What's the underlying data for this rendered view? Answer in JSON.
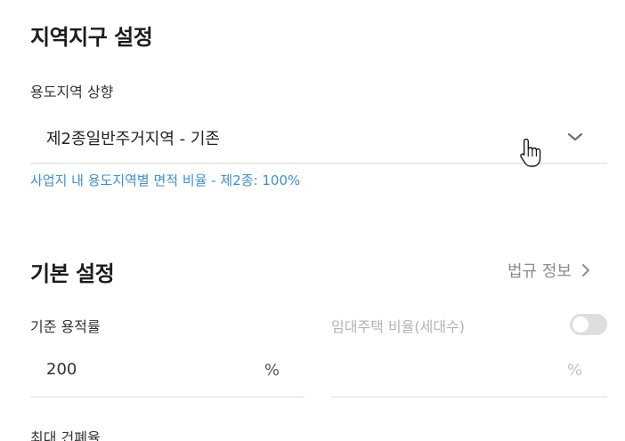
{
  "zoning": {
    "title": "지역지구 설정",
    "upgrade_label": "용도지역 상향",
    "selected": "제2종일반주거지역 - 기존",
    "hint": "사업지 내 용도지역별 면적 비율 - 제2종: 100%"
  },
  "basic": {
    "title": "기본 설정",
    "law_link": "법규 정보",
    "far_label": "기준 용적률",
    "far_value": "200",
    "far_unit": "%",
    "rental_label": "임대주택 비율(세대수)",
    "rental_enabled": false,
    "rental_unit": "%",
    "bcr_label": "최대 건폐율"
  },
  "icons": {
    "select_chevron": "chevron-down-icon",
    "law_chevron": "chevron-right-icon",
    "cursor": "hand-pointer-cursor-icon"
  },
  "colors": {
    "hint": "#3d8fd6",
    "toggle_off": "#dedede"
  }
}
